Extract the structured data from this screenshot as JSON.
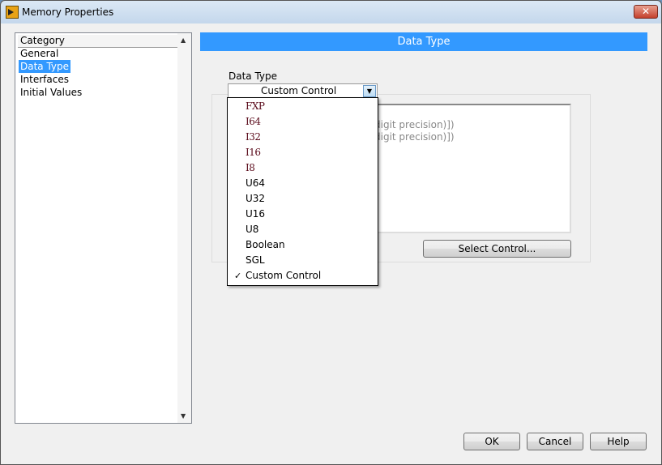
{
  "window": {
    "title": "Memory Properties",
    "close_label": "✕"
  },
  "category": {
    "header": "Category",
    "items": [
      {
        "label": "General"
      },
      {
        "label": "Data Type",
        "selected": true
      },
      {
        "label": "Interfaces"
      },
      {
        "label": "Initial Values"
      }
    ]
  },
  "banner": "Data Type",
  "data_type": {
    "label": "Data Type",
    "selected": "Custom Control",
    "options": [
      "FXP",
      "I64",
      "I32",
      "I16",
      "I8",
      "U64",
      "U32",
      "U16",
      "U8",
      "Boolean",
      "SGL",
      "Custom Control"
    ]
  },
  "description_lines": [
    ")",
    "digit precision)])",
    "digit precision)])"
  ],
  "select_control_label": "Select Control...",
  "buttons": {
    "ok": "OK",
    "cancel": "Cancel",
    "help": "Help"
  },
  "colors": {
    "accent": "#3399ff",
    "numeric_text": "#5a0a1a"
  }
}
